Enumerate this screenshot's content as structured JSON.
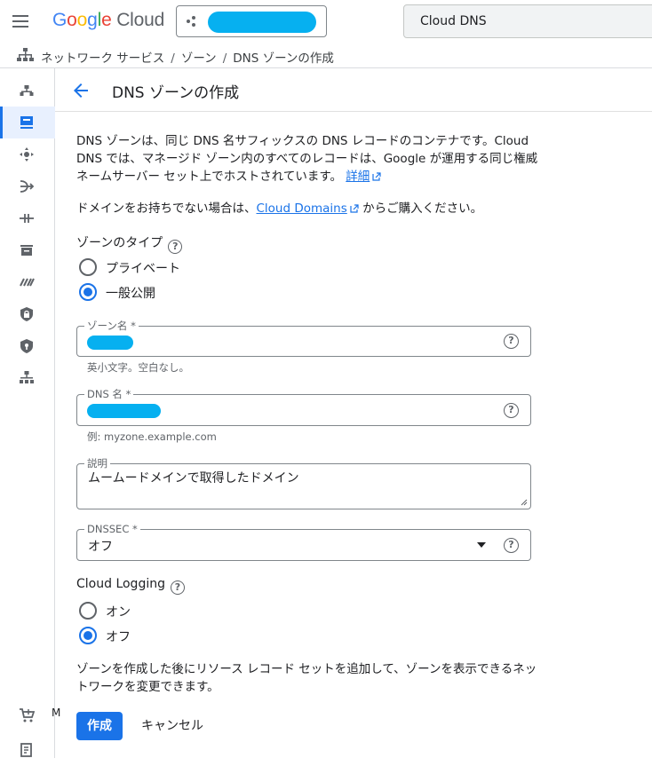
{
  "header": {
    "logo": {
      "letters": [
        "G",
        "o",
        "o",
        "g",
        "l",
        "e"
      ],
      "product": "Cloud"
    },
    "search_value": "Cloud DNS"
  },
  "breadcrumb": {
    "items": [
      "ネットワーク サービス",
      "ゾーン",
      "DNS ゾーンの作成"
    ]
  },
  "sidenav": {
    "icons": [
      "network-topology-icon",
      "dns-zone-icon",
      "load-balancing-icon",
      "routing-icon",
      "interconnect-icon",
      "cdn-icon",
      "private-service-icon",
      "cloud-armor-icon",
      "security-policy-icon",
      "network-services-icon"
    ],
    "bottom_icons": [
      "marketplace-icon",
      "release-notes-icon"
    ],
    "cut_label": "M"
  },
  "page": {
    "title": "DNS ゾーンの作成",
    "description": "DNS ゾーンは、同じ DNS 名サフィックスの DNS レコードのコンテナです。Cloud DNS では、マネージド ゾーン内のすべてのレコードは、Google が運用する同じ権威ネームサーバー セット上でホストされています。",
    "description_link": "詳細",
    "domains_prefix": "ドメインをお持ちでない場合は、",
    "domains_link": "Cloud Domains",
    "domains_suffix": " からご購入ください。"
  },
  "zone_type": {
    "label": "ゾーンのタイプ",
    "options": [
      {
        "label": "プライベート",
        "checked": false
      },
      {
        "label": "一般公開",
        "checked": true
      }
    ]
  },
  "fields": {
    "zone_name": {
      "label": "ゾーン名 *",
      "hint": "英小文字。空白なし。"
    },
    "dns_name": {
      "label": "DNS 名 *",
      "hint": "例: myzone.example.com"
    },
    "description": {
      "label": "説明",
      "value": "ムームードメインで取得したドメイン"
    },
    "dnssec": {
      "label": "DNSSEC *",
      "value": "オフ"
    }
  },
  "logging": {
    "label": "Cloud Logging",
    "options": [
      {
        "label": "オン",
        "checked": false
      },
      {
        "label": "オフ",
        "checked": true
      }
    ]
  },
  "footer": {
    "note": "ゾーンを作成した後にリソース レコード セットを追加して、ゾーンを表示できるネットワークを変更できます。",
    "create_label": "作成",
    "cancel_label": "キャンセル"
  },
  "colors": {
    "primary": "#1a73e8",
    "redacted": "#06b0f0",
    "active_nav_bg": "#e8f0fe"
  }
}
